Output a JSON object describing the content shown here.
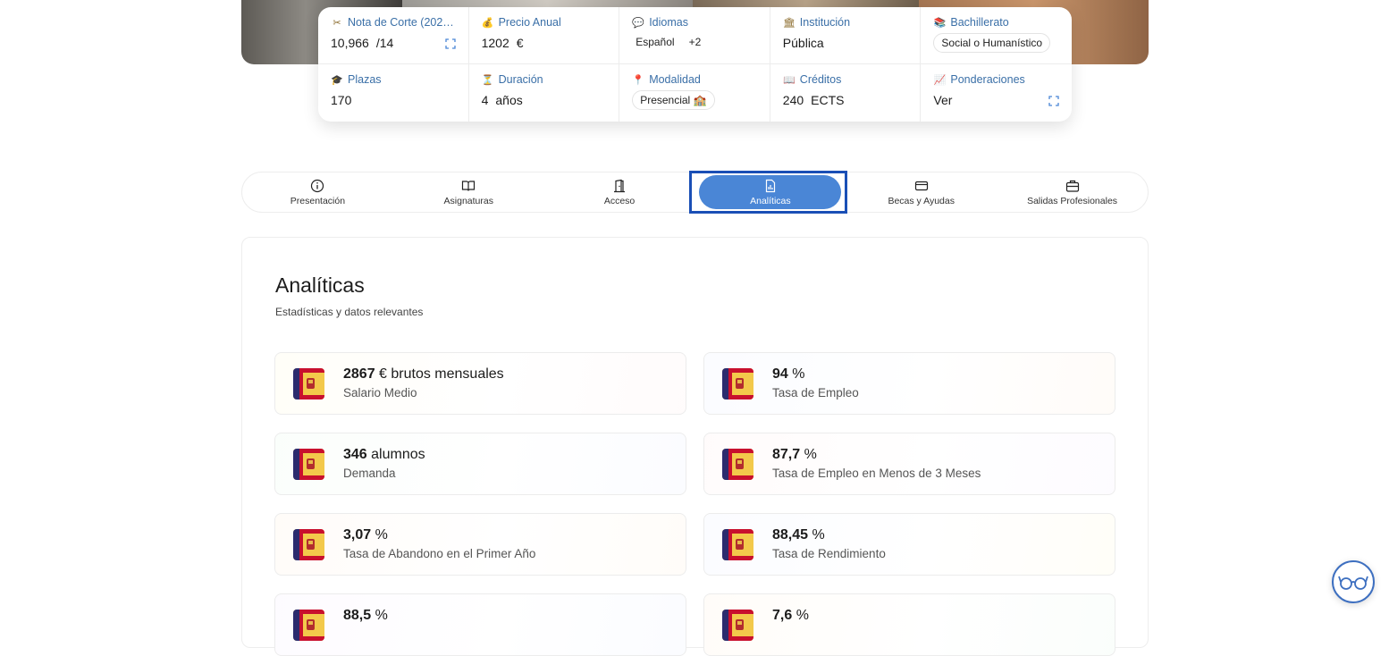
{
  "info": {
    "nota": {
      "label": "Nota de Corte (202…",
      "value": "10,966",
      "suffix": "/14"
    },
    "precio": {
      "label": "Precio Anual",
      "value": "1202",
      "currency": "€"
    },
    "idiomas": {
      "label": "Idiomas",
      "chip": "Español",
      "more": "+2"
    },
    "institucion": {
      "label": "Institución",
      "value": "Pública"
    },
    "bachillerato": {
      "label": "Bachillerato",
      "chip": "Social o Humanístico"
    },
    "plazas": {
      "label": "Plazas",
      "value": "170"
    },
    "duracion": {
      "label": "Duración",
      "value": "4",
      "unit": "años"
    },
    "modalidad": {
      "label": "Modalidad",
      "chip": "Presencial 🏫"
    },
    "creditos": {
      "label": "Créditos",
      "value": "240",
      "unit": "ECTS"
    },
    "ponderaciones": {
      "label": "Ponderaciones",
      "value": "Ver"
    }
  },
  "tabs": [
    {
      "label": "Presentación",
      "icon": "info-icon"
    },
    {
      "label": "Asignaturas",
      "icon": "book-icon"
    },
    {
      "label": "Acceso",
      "icon": "door-icon"
    },
    {
      "label": "Analíticas",
      "icon": "chart-doc-icon",
      "active": true
    },
    {
      "label": "Becas y Ayudas",
      "icon": "card-icon"
    },
    {
      "label": "Salidas Profesionales",
      "icon": "briefcase-icon"
    }
  ],
  "panel": {
    "title": "Analíticas",
    "subtitle": "Estadísticas y datos relevantes"
  },
  "stats": [
    {
      "value": "2867",
      "unit": " € brutos mensuales",
      "caption": "Salario Medio"
    },
    {
      "value": "94",
      "unit": " %",
      "caption": "Tasa de Empleo"
    },
    {
      "value": "346",
      "unit": " alumnos",
      "caption": "Demanda"
    },
    {
      "value": "87,7",
      "unit": " %",
      "caption": "Tasa de Empleo en Menos de 3 Meses"
    },
    {
      "value": "3,07",
      "unit": " %",
      "caption": "Tasa de Abandono en el Primer Año"
    },
    {
      "value": "88,45",
      "unit": " %",
      "caption": "Tasa de Rendimiento"
    },
    {
      "value": "88,5",
      "unit": " %",
      "caption": ""
    },
    {
      "value": "7,6",
      "unit": " %",
      "caption": ""
    }
  ],
  "colors": {
    "accent": "#4a86d6",
    "focus": "#1a4fb6",
    "label": "#3a6fa7"
  }
}
